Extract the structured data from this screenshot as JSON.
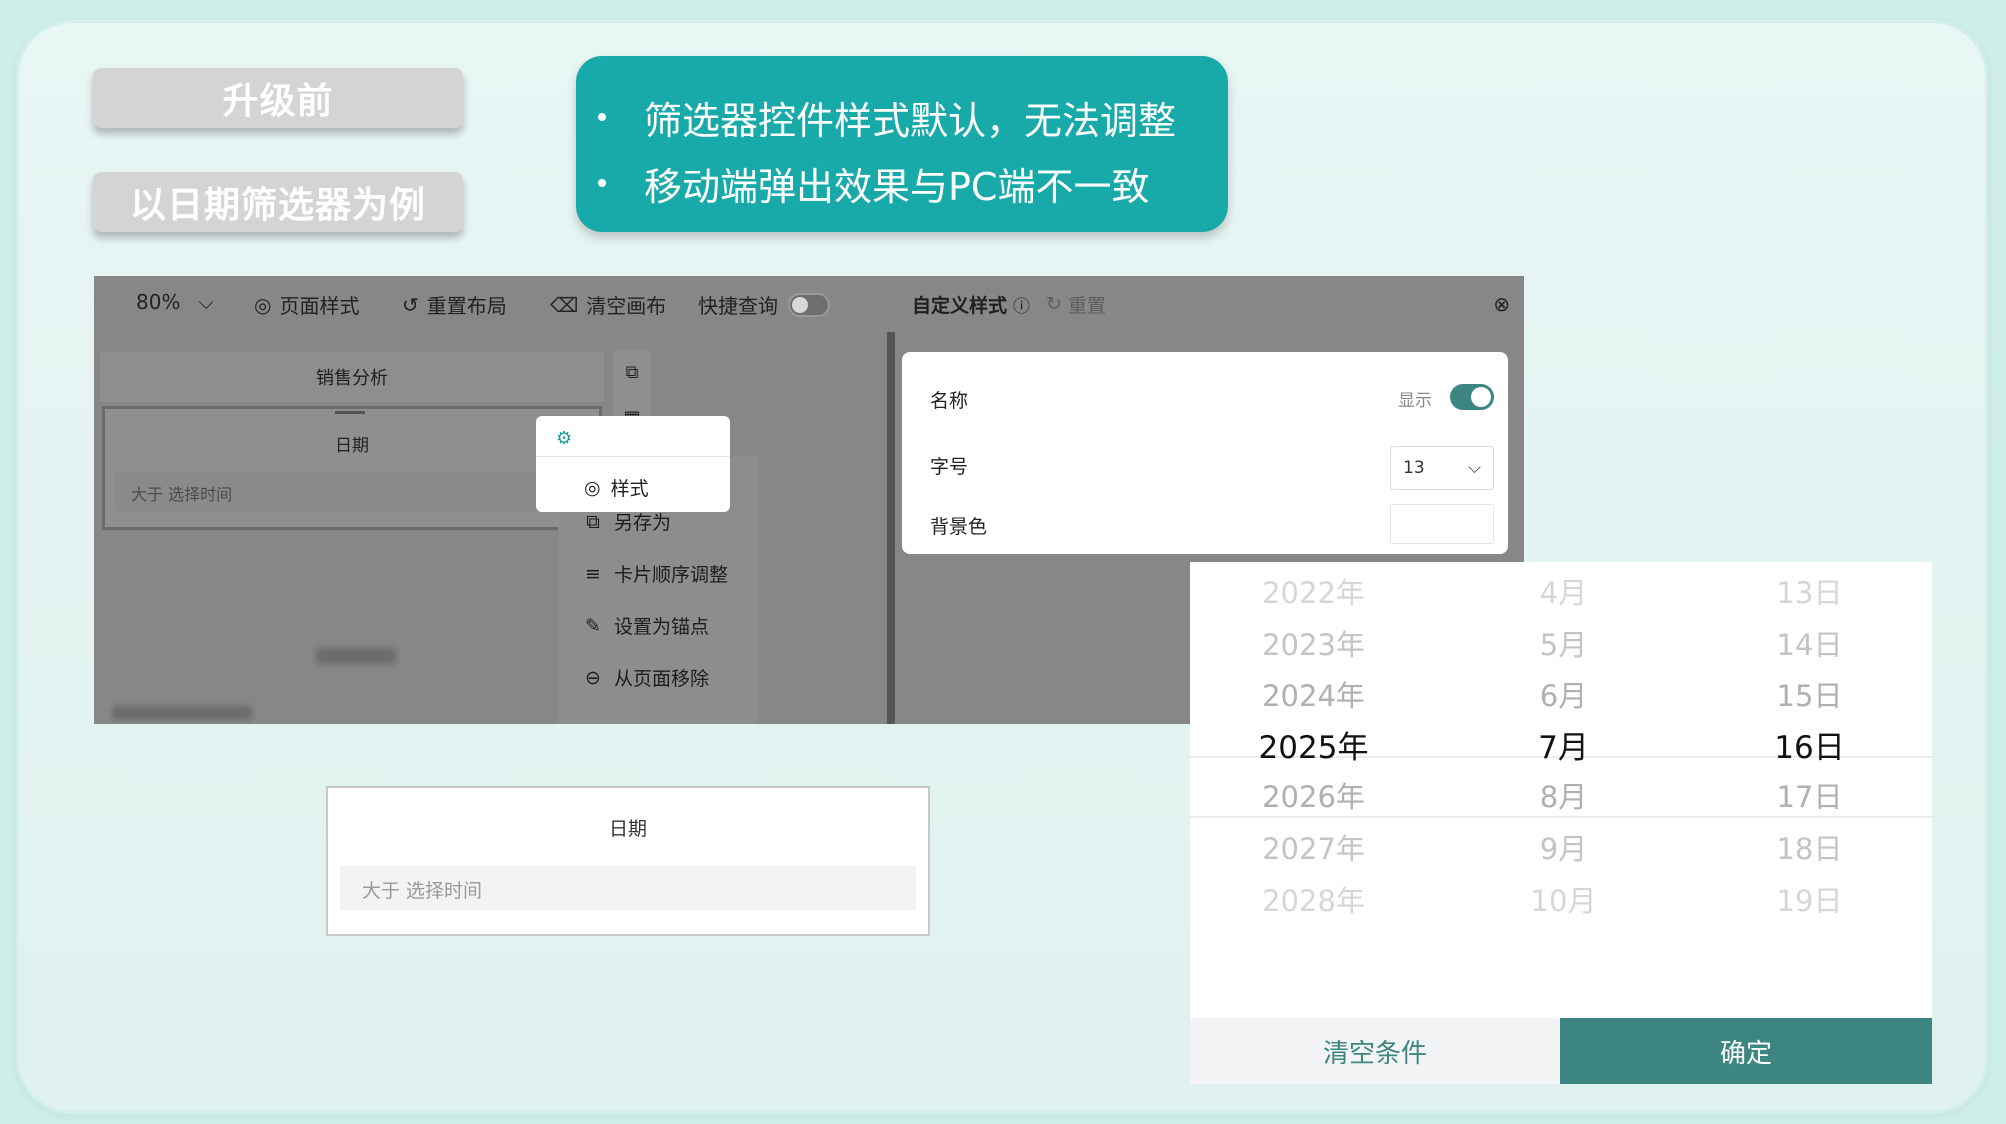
{
  "tags": {
    "before": "升级前",
    "example": "以日期筛选器为例"
  },
  "callout": {
    "points": [
      "筛选器控件样式默认，无法调整",
      "移动端弹出效果与PC端不一致"
    ]
  },
  "editor": {
    "toolbar": {
      "zoom": "80%",
      "page_style": "页面样式",
      "reset_layout": "重置布局",
      "clear_canvas": "清空画布",
      "quick_query": "快捷查询"
    },
    "canvas": {
      "card_title": "销售分析",
      "date_label": "日期",
      "date_placeholder": "大于  选择时间"
    },
    "context_menu": {
      "items": [
        "样式",
        "另存为",
        "卡片顺序调整",
        "设置为锚点",
        "从页面移除"
      ]
    },
    "custom_style": {
      "title": "自定义样式",
      "reset": "重置",
      "name_label": "名称",
      "show_label": "显示",
      "font_size_label": "字号",
      "font_size_value": "13",
      "bg_color_label": "背景色"
    }
  },
  "pc_filter": {
    "label": "日期",
    "placeholder": "大于  选择时间"
  },
  "mobile_picker": {
    "years": [
      "2022年",
      "2023年",
      "2024年",
      "2025年",
      "2026年",
      "2027年",
      "2028年"
    ],
    "months": [
      "4月",
      "5月",
      "6月",
      "7月",
      "8月",
      "9月",
      "10月"
    ],
    "days": [
      "13日",
      "14日",
      "15日",
      "16日",
      "17日",
      "18日",
      "19日"
    ],
    "clear_label": "清空条件",
    "confirm_label": "确定"
  }
}
